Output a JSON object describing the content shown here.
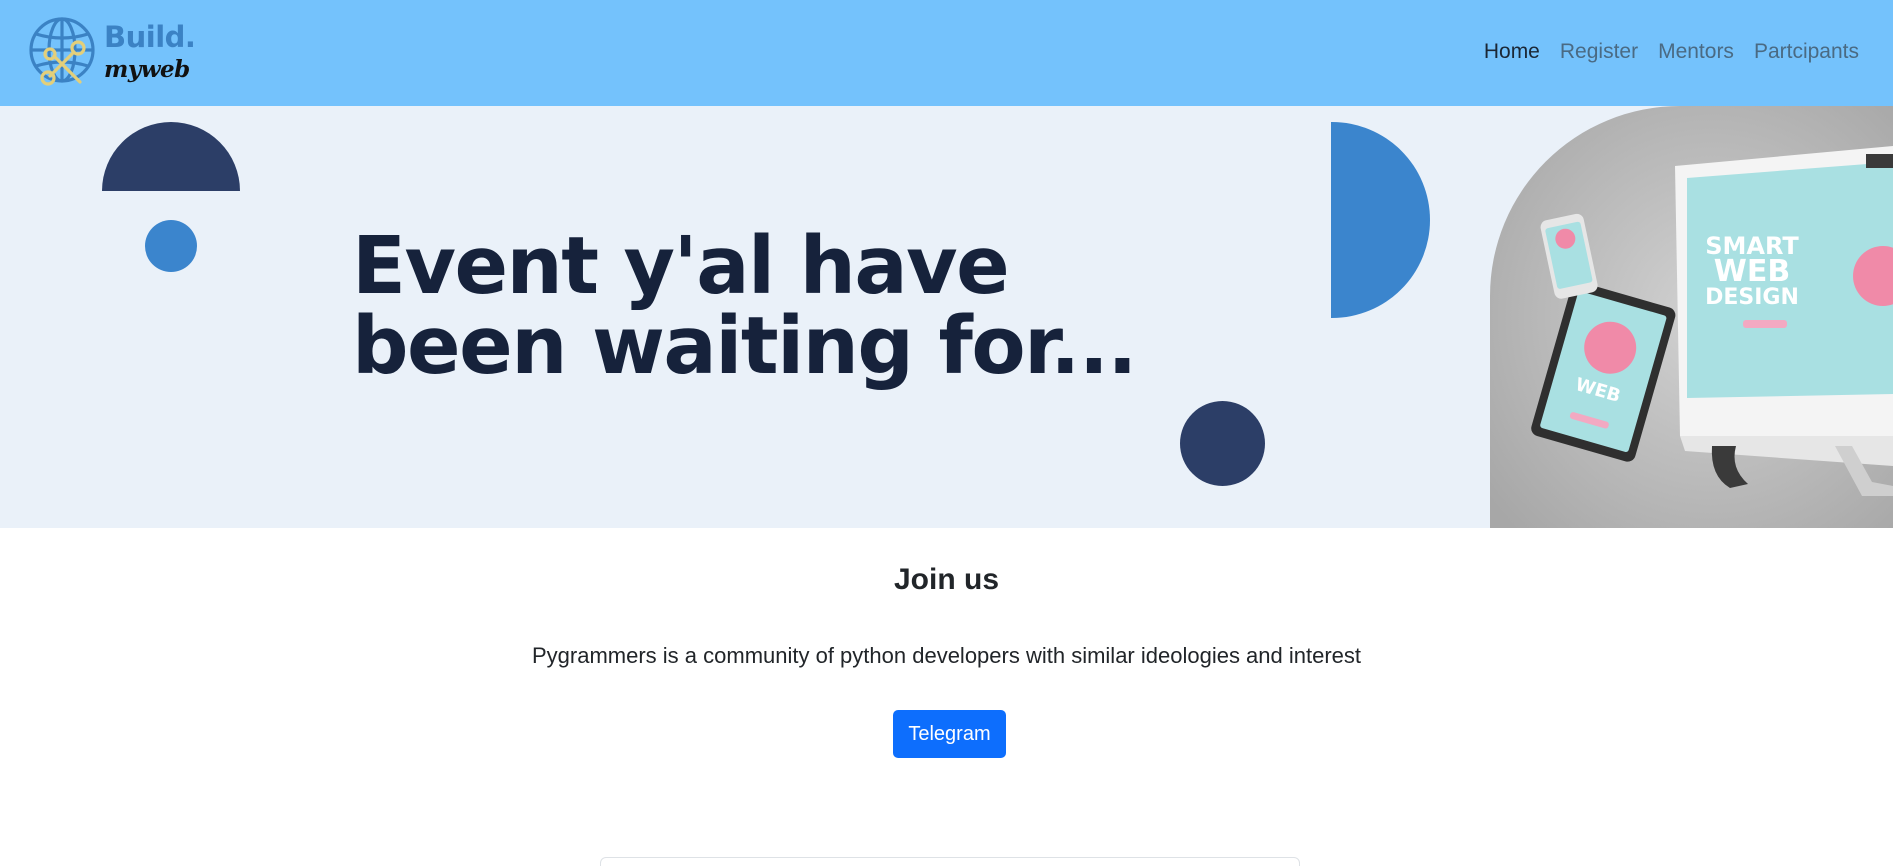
{
  "brand": {
    "line1": "Build.",
    "line2": "myweb",
    "logo_icon": "globe-wrench-icon"
  },
  "nav": {
    "items": [
      {
        "label": "Home",
        "active": true
      },
      {
        "label": "Register",
        "active": false
      },
      {
        "label": "Mentors",
        "active": false
      },
      {
        "label": "Partcipants",
        "active": false
      }
    ]
  },
  "hero": {
    "title_line1": "Event y'al have",
    "title_line2": "been waiting for...",
    "image": {
      "screen_text_line1": "SMART",
      "screen_text_line2": "WEB",
      "screen_text_line3": "DESIGN"
    }
  },
  "section": {
    "title": "Join us",
    "text": "Pygrammers is a community of python developers with similar ideologies and interest",
    "button_label": "Telegram"
  },
  "colors": {
    "navbar": "#74c2fc",
    "hero_bg": "#eaf1f9",
    "navy": "#2c3e67",
    "blue": "#3b85cd",
    "button": "#0d6efd"
  }
}
